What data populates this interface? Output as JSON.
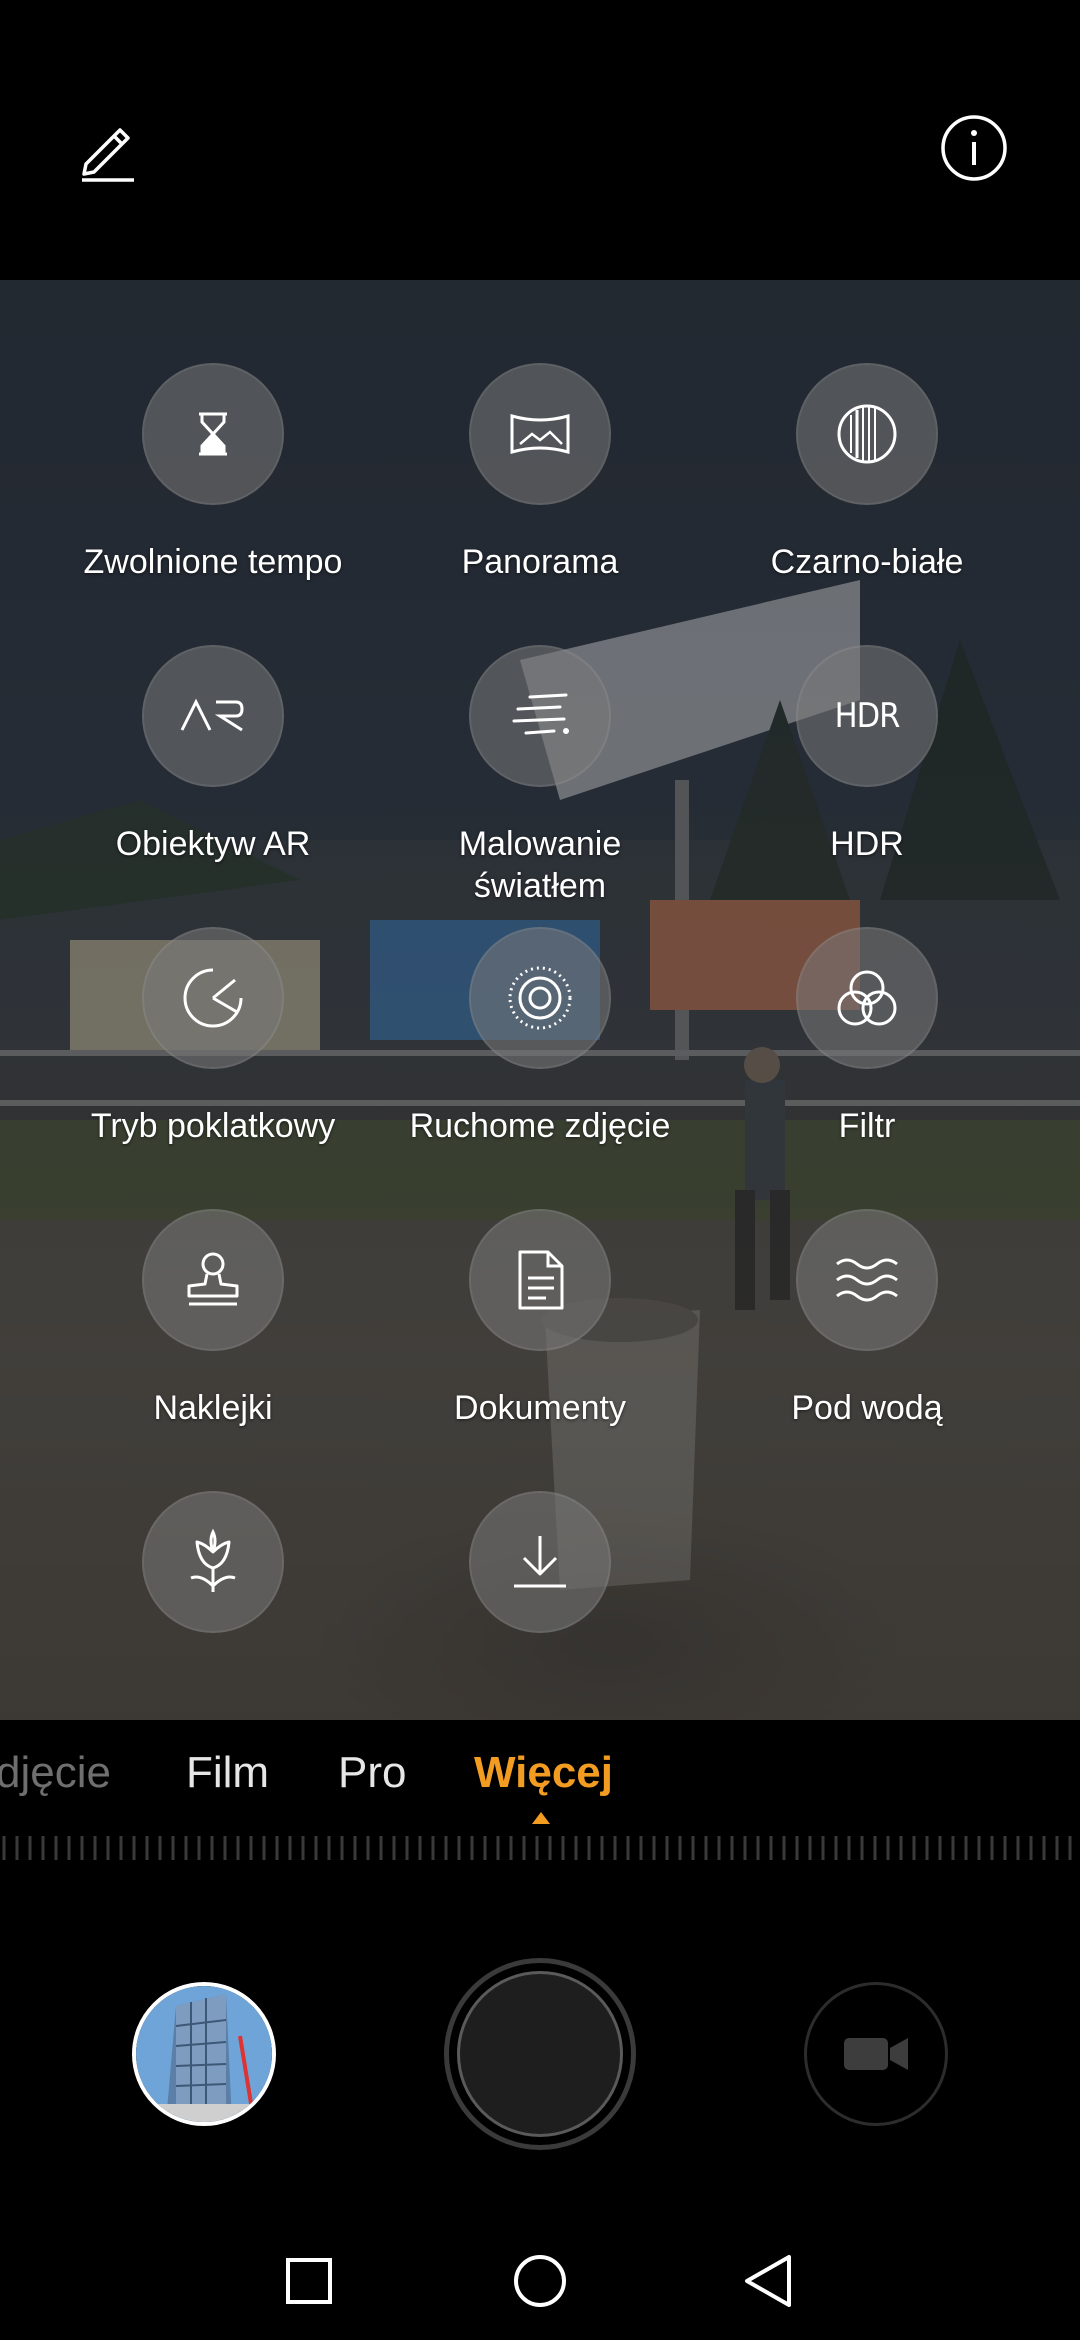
{
  "top_bar": {
    "edit_icon": "pencil-icon",
    "info_icon": "info-icon"
  },
  "modes_grid": [
    {
      "label": "Zwolnione tempo",
      "icon": "hourglass-icon"
    },
    {
      "label": "Panorama",
      "icon": "panorama-icon"
    },
    {
      "label": "Czarno-białe",
      "icon": "monochrome-icon"
    },
    {
      "label": "Obiektyw AR",
      "icon": "ar-icon",
      "icon_text": "AR"
    },
    {
      "label": "Malowanie\nświatłem",
      "icon": "light-painting-icon"
    },
    {
      "label": "HDR",
      "icon": "hdr-icon",
      "icon_text": "HDR"
    },
    {
      "label": "Tryb poklatkowy",
      "icon": "time-lapse-icon"
    },
    {
      "label": "Ruchome zdjęcie",
      "icon": "moving-picture-icon"
    },
    {
      "label": "Filtr",
      "icon": "filter-icon"
    },
    {
      "label": "Naklejki",
      "icon": "sticker-stamp-icon"
    },
    {
      "label": "Dokumenty",
      "icon": "document-icon"
    },
    {
      "label": "Pod wodą",
      "icon": "underwater-waves-icon"
    },
    {
      "label": "",
      "icon": "flower-icon"
    },
    {
      "label": "",
      "icon": "download-icon"
    }
  ],
  "mode_strip": {
    "tabs": [
      "djęcie",
      "Film",
      "Pro",
      "Więcej"
    ],
    "active_index": 3,
    "active_color": "#f39c22"
  },
  "controls": {
    "gallery_icon": "gallery-thumbnail",
    "shutter_icon": "shutter-button",
    "video_icon": "video-camera-icon"
  },
  "nav": {
    "recents_icon": "square-icon",
    "home_icon": "circle-icon",
    "back_icon": "triangle-back-icon"
  }
}
